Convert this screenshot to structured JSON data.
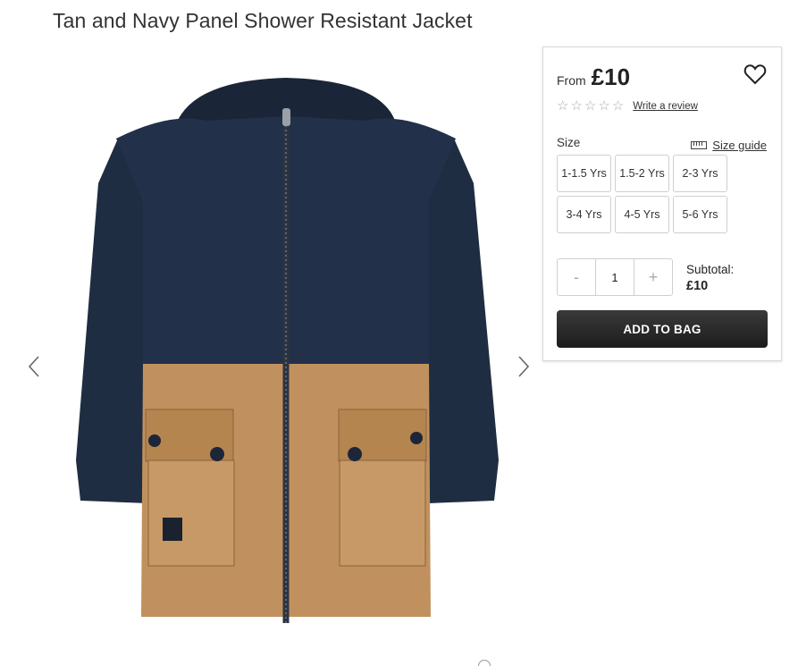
{
  "product": {
    "title": "Tan and Navy Panel Shower Resistant Jacket",
    "price_prefix": "From",
    "price": "£10",
    "rating_stars": 0,
    "rating_max": 5,
    "write_review_label": "Write a review"
  },
  "size_selector": {
    "label": "Size",
    "guide_label": "Size guide",
    "options": [
      "1-1.5 Yrs",
      "1.5-2 Yrs",
      "2-3 Yrs",
      "3-4 Yrs",
      "4-5 Yrs",
      "5-6 Yrs"
    ]
  },
  "quantity": {
    "decrement": "-",
    "value": "1",
    "increment": "+"
  },
  "subtotal": {
    "label": "Subtotal:",
    "value": "£10"
  },
  "actions": {
    "add_to_bag": "ADD TO BAG"
  },
  "icons": {
    "wishlist": "heart-icon",
    "prev": "chevron-left-icon",
    "next": "chevron-right-icon",
    "size_guide": "ruler-icon",
    "star": "star-outline-icon"
  },
  "colors": {
    "navy": "#1f2d42",
    "tan": "#c0915f",
    "button": "#222222"
  }
}
